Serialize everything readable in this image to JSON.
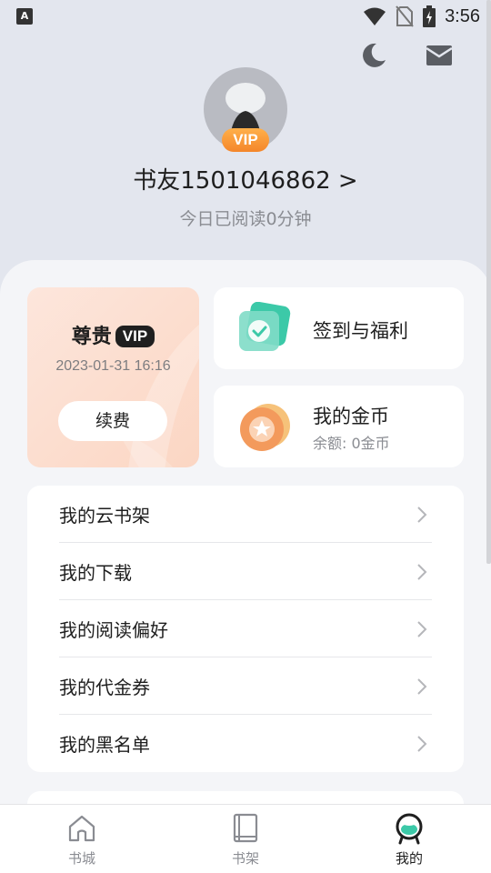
{
  "status_bar": {
    "app_indicator": "A",
    "time": "3:56"
  },
  "header": {
    "night_mode_icon": "moon-icon",
    "message_icon": "mail-icon"
  },
  "profile": {
    "badge": "VIP",
    "username": "书友1501046862 >",
    "read_today": "今日已阅读0分钟"
  },
  "vip_card": {
    "title": "尊贵",
    "tag": "VIP",
    "expiry": "2023-01-31 16:16",
    "renew_label": "续费"
  },
  "tiles": {
    "checkin": {
      "title": "签到与福利",
      "icon": "checkin-icon"
    },
    "coins": {
      "title": "我的金币",
      "balance": "余额: 0金币",
      "icon": "coin-icon"
    }
  },
  "menu": {
    "items": [
      {
        "label": "我的云书架"
      },
      {
        "label": "我的下载"
      },
      {
        "label": "我的阅读偏好"
      },
      {
        "label": "我的代金券"
      },
      {
        "label": "我的黑名单"
      }
    ]
  },
  "bottom_nav": {
    "items": [
      {
        "label": "书城",
        "icon": "store-icon"
      },
      {
        "label": "书架",
        "icon": "bookshelf-icon"
      },
      {
        "label": "我的",
        "icon": "profile-icon",
        "active": true
      }
    ]
  },
  "colors": {
    "accent_orange": "#f4862a",
    "vip_card_bg": "#fbd6c3",
    "checkin_green": "#3cc9a8"
  }
}
